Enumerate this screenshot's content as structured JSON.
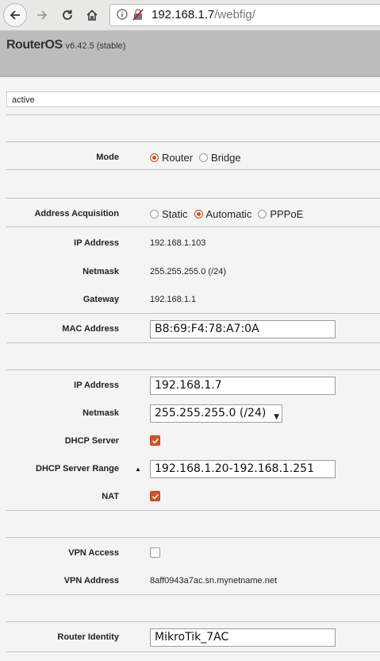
{
  "browser": {
    "url_host": "192.168.1.7",
    "url_path": "/webfig/"
  },
  "header": {
    "brand": "RouterOS",
    "version": "v6.42.5 (stable)"
  },
  "status": "active",
  "mode": {
    "label": "Mode",
    "options": [
      "Router",
      "Bridge"
    ],
    "selected": "Router"
  },
  "address_acquisition": {
    "label": "Address Acquisition",
    "options": [
      "Static",
      "Automatic",
      "PPPoE"
    ],
    "selected": "Automatic"
  },
  "wan": {
    "ip_label": "IP Address",
    "ip_value": "192.168.1.103",
    "netmask_label": "Netmask",
    "netmask_value": "255.255.255.0 (/24)",
    "gateway_label": "Gateway",
    "gateway_value": "192.168.1.1",
    "mac_label": "MAC Address",
    "mac_value": "B8:69:F4:78:A7:0A"
  },
  "lan": {
    "ip_label": "IP Address",
    "ip_value": "192.168.1.7",
    "netmask_label": "Netmask",
    "netmask_value": "255.255.255.0 (/24)",
    "dhcp_label": "DHCP Server",
    "dhcp_checked": true,
    "dhcp_range_label": "DHCP Server Range",
    "dhcp_range_value": "192.168.1.20-192.168.1.251",
    "nat_label": "NAT",
    "nat_checked": true
  },
  "vpn": {
    "access_label": "VPN Access",
    "access_checked": false,
    "address_label": "VPN Address",
    "address_value": "8aff0943a7ac.sn.mynetname.net"
  },
  "identity": {
    "label": "Router Identity",
    "value": "MikroTik_7AC"
  },
  "colors": {
    "accent": "#d9531e",
    "header_bg": "#bcbcbc",
    "page_bg": "#f4f4f4"
  }
}
